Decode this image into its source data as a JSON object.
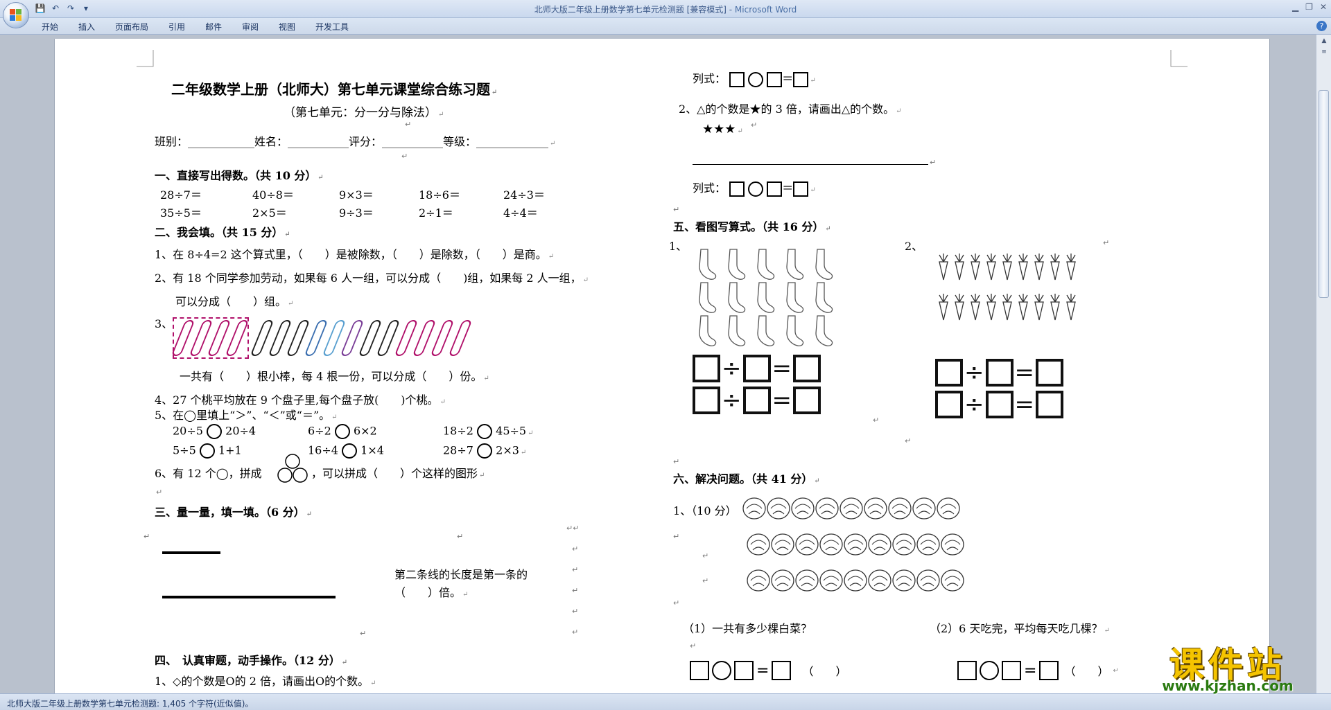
{
  "window": {
    "title": "北师大版二年级上册数学第七单元检测题 [兼容模式] - ",
    "app_name": "Microsoft Word"
  },
  "qat": {
    "save": "💾",
    "undo": "↶",
    "redo": "↷",
    "customize": "▾"
  },
  "menu": [
    "开始",
    "插入",
    "页面布局",
    "引用",
    "邮件",
    "审阅",
    "视图",
    "开发工具"
  ],
  "help": "?",
  "status": {
    "text": "北师大版二年级上册数学第七单元检测题: 1,405 个字符(近似值)。"
  },
  "doc": {
    "title": "二年级数学上册（北师大）第七单元课堂综合练习题",
    "subtitle": "（第七单元：分一分与除法）",
    "info_line": "班别：____________姓名：___________评分：___________等级：_____________",
    "s1": {
      "heading": "一、直接写出得数。（共 10 分）",
      "row1": [
        "28÷7＝",
        "40÷8＝",
        "9×3＝",
        "18÷6＝",
        "24÷3＝"
      ],
      "row2": [
        "35÷5＝",
        "2×5＝",
        "9÷3＝",
        "2÷1＝",
        "4÷4＝"
      ]
    },
    "s2": {
      "heading": "二、我会填。（共 15 分）",
      "q1": "1、在 8÷4=2 这个算式里，（　　）是被除数，（　　）是除数，（　　）是商。",
      "q2a": "2、有 18 个同学参加劳动，如果每 6 人一组，可以分成（　　)组，如果每 2 人一组，",
      "q2b": "可以分成（　　）组。",
      "q3_num": "3、",
      "q3_text": "一共有（　　）根小棒，每 4 根一份，可以分成（　　）份。",
      "q4": "4、27 个桃平均放在 9 个盘子里,每个盘子放(　　)个桃。",
      "q5": "5、在◯里填上“＞”、“＜”或“＝”。",
      "q5_r1": [
        "20÷5",
        "20÷4",
        "6÷2",
        "6×2",
        "18÷2",
        "45÷5"
      ],
      "q5_r2": [
        "5÷5",
        "1+1",
        "16÷4",
        "1×4",
        "28÷7",
        "2×3"
      ],
      "q6a": "6、有 12 个◯，拼成",
      "q6b": "，可以拼成（　　）个这样的图形"
    },
    "s3": {
      "heading": "三、量一量，填一填。（6 分）",
      "text1": "第二条线的长度是第一条的",
      "text2": "（　　）倍。"
    },
    "s4": {
      "heading": "四、　认真审题，动手操作。（12 分）",
      "q1": "1、◇的个数是O的 2 倍，请画出O的个数。",
      "formula": "列式：",
      "q2": "2、△的个数是★的 3 倍，请画出△的个数。",
      "stars": "★★★"
    },
    "s5": {
      "heading": "五、看图写算式。（共 16 分）",
      "n1": "1、",
      "n2": "2、",
      "op_div": "÷",
      "op_eq": "="
    },
    "s6": {
      "heading": "六、解决问题。（共 41 分）",
      "q1": "1、（10 分）",
      "sub1": "（1）一共有多少棵白菜？",
      "sub2": "（2）6 天吃完，平均每天吃几棵？",
      "paren": "（　　）"
    }
  },
  "watermark": {
    "brand": "课件站",
    "url": "www.kjzhan.com"
  },
  "colors": {
    "title_text": "#3d5a8a",
    "accent": "#4a6fa5",
    "watermark_yellow": "#f5c400",
    "watermark_green": "#2a7a10"
  }
}
